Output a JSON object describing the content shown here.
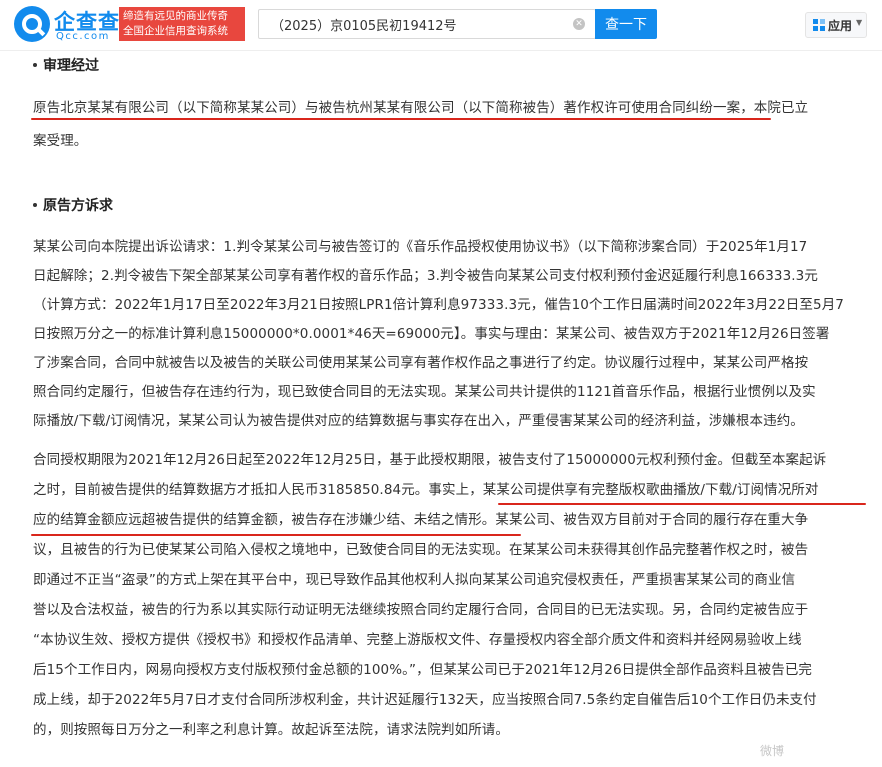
{
  "header": {
    "brand_name": "企查查",
    "brand_domain": "Qcc.com",
    "slogan_line1": "缔造有远见的商业传奇",
    "slogan_line2": "全国企业信用查询系统",
    "search_value": "（2025）京0105民初19412号",
    "search_button": "查一下",
    "app_button": "应用"
  },
  "sections": {
    "process_title": "审理经过",
    "claims_title": "原告方诉求"
  },
  "process_lines": [
    "原告北京某某有限公司（以下简称某某公司）与被告杭州某某有限公司（以下简称被告）著作权许可使用合同纠纷一案，本院已立",
    "案受理。"
  ],
  "claims_lines": [
    "某某公司向本院提出诉讼请求：1.判令某某公司与被告签订的《音乐作品授权使用协议书》（以下简称涉案合同）于2025年1月17",
    "日起解除；2.判令被告下架全部某某公司享有著作权的音乐作品；3.判令被告向某某公司支付权利预付金迟延履行利息166333.3元",
    "（计算方式：2022年1月17日至2022年3月21日按照LPR1倍计算利息97333.3元，催告10个工作日届满时间2022年3月22日至5月7",
    "日按照万分之一的标准计算利息15000000*0.0001*46天=69000元】。事实与理由：某某公司、被告双方于2021年12月26日签署",
    "了涉案合同，合同中就被告以及被告的关联公司使用某某公司享有著作权作品之事进行了约定。协议履行过程中，某某公司严格按",
    "照合同约定履行，但被告存在违约行为，现已致使合同目的无法实现。某某公司共计提供的1121首音乐作品，根据行业惯例以及实",
    "际播放/下载/订阅情况，某某公司认为被告提供对应的结算数据与事实存在出入，严重侵害某某公司的经济利益，涉嫌根本违约。",
    "合同授权期限为2021年12月26日起至2022年12月25日，基于此授权期限，被告支付了15000000元权利预付金。但截至本案起诉",
    "之时，目前被告提供的结算数据方才抵扣人民币3185850.84元。事实上，某某公司提供享有完整版权歌曲播放/下载/订阅情况所对",
    "应的结算金额应远超被告提供的结算金额，被告存在涉嫌少结、未结之情形。某某公司、被告双方目前对于合同的履行存在重大争",
    "议，且被告的行为已使某某公司陷入侵权之境地中，已致使合同目的无法实现。在某某公司未获得其创作品完整著作权之时，被告",
    "即通过不正当“盗录”的方式上架在其平台中，现已导致作品其他权利人拟向某某公司追究侵权责任，严重损害某某公司的商业信",
    "誉以及合法权益，被告的行为系以其实际行动证明无法继续按照合同约定履行合同，合同目的已无法实现。另，合同约定被告应于",
    "“本协议生效、授权方提供《授权书》和授权作品清单、完整上游版权文件、存量授权内容全部介质文件和资料并经网易验收上线",
    "后15个工作日内，网易向授权方支付版权预付金总额的100%。”，但某某公司已于2021年12月26日提供全部作品资料且被告已完",
    "成上线，却于2022年5月7日才支付合同所涉权利金，共计迟延履行132天，应当按照合同7.5条约定自催告后10个工作日仍未支付",
    "的，则按照每日万分之一利率之利息计算。故起诉至法院，请求法院判如所请。"
  ],
  "watermark": "微博",
  "colors": {
    "brand": "#128bed",
    "slogan_bg": "#e8473e",
    "highlight_underline": "#d9261c"
  }
}
